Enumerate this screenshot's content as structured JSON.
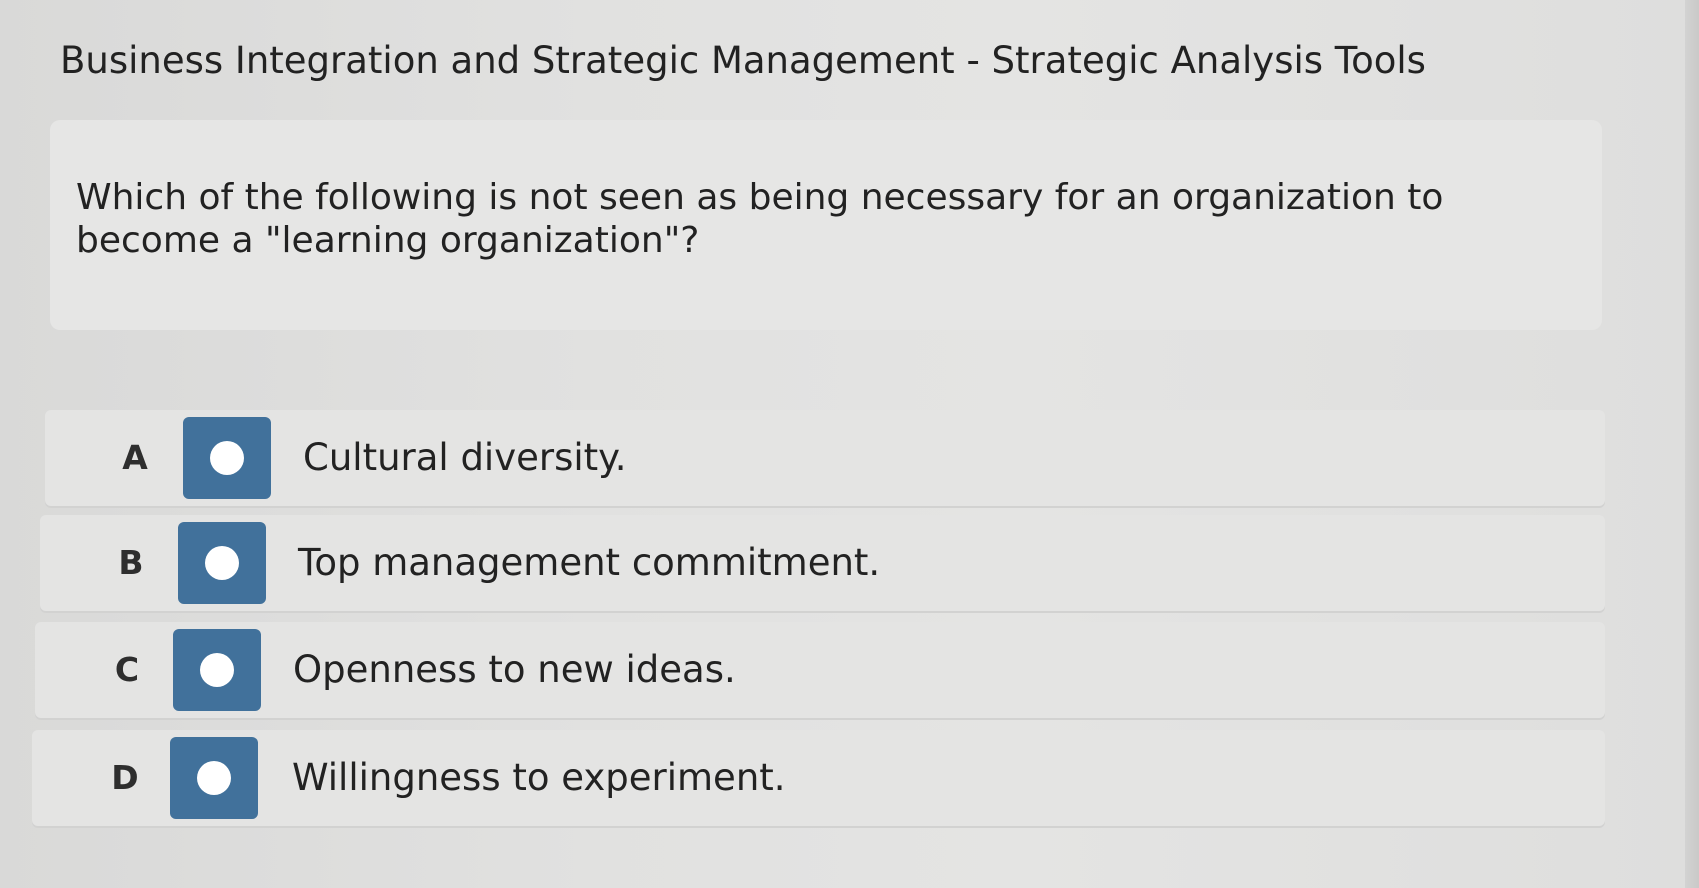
{
  "page": {
    "title": "Business Integration and Strategic Management - Strategic Analysis Tools"
  },
  "question": {
    "text": "Which of the following is not seen as being necessary for an organization to become a \"learning organization\"?"
  },
  "options": [
    {
      "letter": "A",
      "label": "Cultural diversity."
    },
    {
      "letter": "B",
      "label": "Top management commitment."
    },
    {
      "letter": "C",
      "label": "Openness to new ideas."
    },
    {
      "letter": "D",
      "label": "Willingness to experiment."
    }
  ],
  "colors": {
    "radio_box": "#41719b",
    "radio_circle": "#ffffff",
    "background": "#dcdcdb"
  },
  "icons": {
    "radio": "radio-unselected-icon"
  }
}
